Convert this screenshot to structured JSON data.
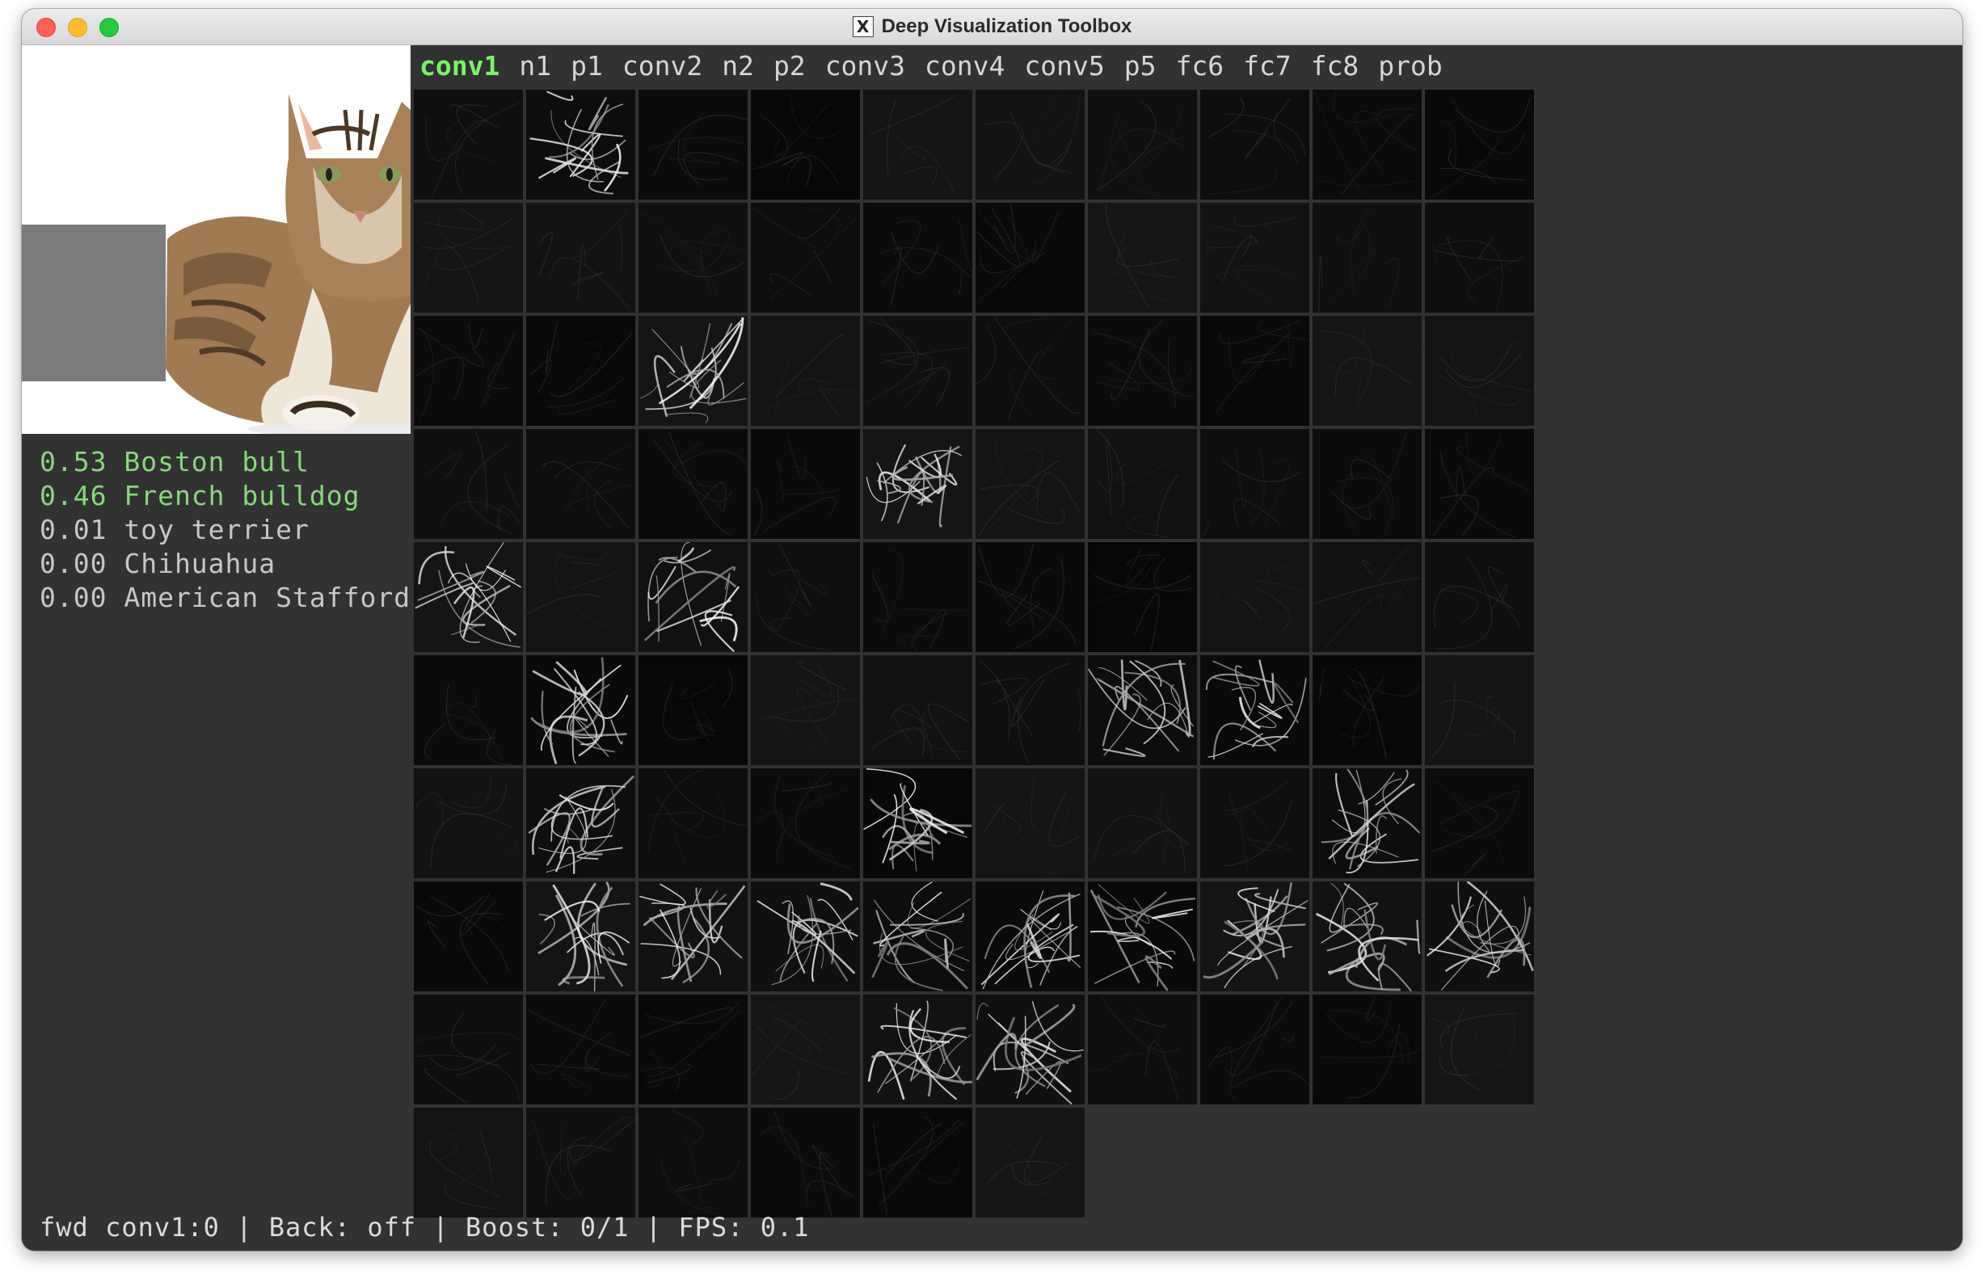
{
  "window": {
    "title": "Deep Visualization Toolbox",
    "app_icon": "x11-icon",
    "traffic_lights": [
      "close",
      "minimize",
      "zoom"
    ]
  },
  "layer_tabs": [
    {
      "label": "conv1",
      "active": true
    },
    {
      "label": "n1"
    },
    {
      "label": "p1"
    },
    {
      "label": "conv2"
    },
    {
      "label": "n2"
    },
    {
      "label": "p2"
    },
    {
      "label": "conv3"
    },
    {
      "label": "conv4"
    },
    {
      "label": "conv5"
    },
    {
      "label": "p5"
    },
    {
      "label": "fc6"
    },
    {
      "label": "fc7"
    },
    {
      "label": "fc8"
    },
    {
      "label": "prob"
    }
  ],
  "input_image": {
    "subject": "tabby cat lying down on white background",
    "occluder": "gray rectangle"
  },
  "predictions": [
    {
      "text": "0.53 Boston bull",
      "color": "#86d97a"
    },
    {
      "text": "0.46 French bulldog",
      "color": "#86d97a"
    },
    {
      "text": "0.01 toy terrier",
      "color": "#c7c7c7"
    },
    {
      "text": "0.00 Chihuahua",
      "color": "#c7c7c7"
    },
    {
      "text": "0.00 American Stafford",
      "color": "#c7c7c7"
    }
  ],
  "activation_grid": {
    "columns": 10,
    "count": 96,
    "bright_cells": [
      1,
      22,
      34,
      40,
      42,
      51,
      56,
      57,
      61,
      64,
      68,
      71,
      72,
      73,
      74,
      75,
      76,
      77,
      78,
      79,
      84,
      85
    ]
  },
  "status_bar": {
    "text": "fwd conv1:0 | Back: off | Boost: 0/1 | FPS: 0.1"
  },
  "colors": {
    "background": "#323232",
    "active_tab": "#7bf26b",
    "top_prediction": "#86d97a"
  }
}
